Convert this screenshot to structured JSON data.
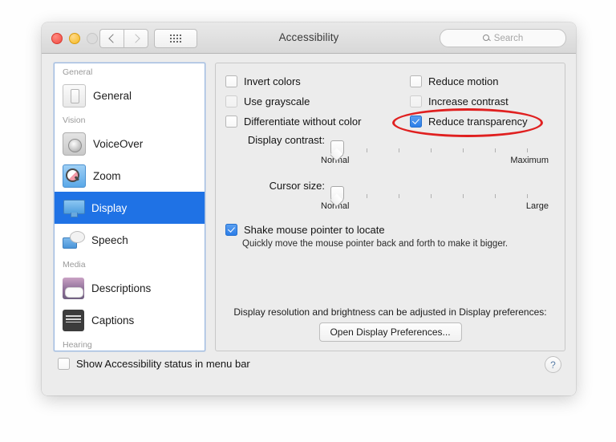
{
  "window": {
    "title": "Accessibility",
    "traffic_lights": [
      "close-red",
      "minimize-yellow",
      "zoom-gray-disabled"
    ],
    "nav": {
      "back": "‹",
      "forward": "›"
    },
    "grid_button": "show-all-icon",
    "search": {
      "placeholder": "Search",
      "value": "",
      "icon": "search-icon"
    }
  },
  "sidebar": {
    "groups": [
      {
        "label": "General",
        "items": [
          {
            "label": "General",
            "icon": "general-icon",
            "selected": false
          }
        ]
      },
      {
        "label": "Vision",
        "items": [
          {
            "label": "VoiceOver",
            "icon": "voiceover-icon",
            "selected": false
          },
          {
            "label": "Zoom",
            "icon": "zoom-icon",
            "selected": false
          },
          {
            "label": "Display",
            "icon": "display-icon",
            "selected": true
          },
          {
            "label": "Speech",
            "icon": "speech-icon",
            "selected": false
          }
        ]
      },
      {
        "label": "Media",
        "items": [
          {
            "label": "Descriptions",
            "icon": "descriptions-icon",
            "selected": false
          },
          {
            "label": "Captions",
            "icon": "captions-icon",
            "selected": false
          }
        ]
      },
      {
        "label": "Hearing",
        "items": []
      }
    ]
  },
  "main": {
    "checkboxes": {
      "left": [
        {
          "label": "Invert colors",
          "checked": false,
          "enabled": true
        },
        {
          "label": "Use grayscale",
          "checked": false,
          "enabled": false
        },
        {
          "label": "Differentiate without color",
          "checked": false,
          "enabled": true
        }
      ],
      "right": [
        {
          "label": "Reduce motion",
          "checked": false,
          "enabled": true
        },
        {
          "label": "Increase contrast",
          "checked": false,
          "enabled": false
        },
        {
          "label": "Reduce transparency",
          "checked": true,
          "enabled": true
        }
      ]
    },
    "annotation": {
      "shape": "red-oval",
      "color": "#e02020",
      "targets": "Reduce transparency"
    },
    "sliders": [
      {
        "label": "Display contrast:",
        "value": 0,
        "min_label": "Normal",
        "max_label": "Maximum",
        "ticks": 6
      },
      {
        "label": "Cursor size:",
        "value": 0,
        "min_label": "Normal",
        "max_label": "Large",
        "ticks": 6
      }
    ],
    "shake": {
      "label": "Shake mouse pointer to locate",
      "checked": true,
      "description": "Quickly move the mouse pointer back and forth to make it bigger."
    },
    "footer": {
      "note": "Display resolution and brightness can be adjusted in Display preferences:",
      "button": "Open Display Preferences..."
    }
  },
  "bottom_bar": {
    "status_checkbox": {
      "label": "Show Accessibility status in menu bar",
      "checked": false
    },
    "help": "?"
  }
}
